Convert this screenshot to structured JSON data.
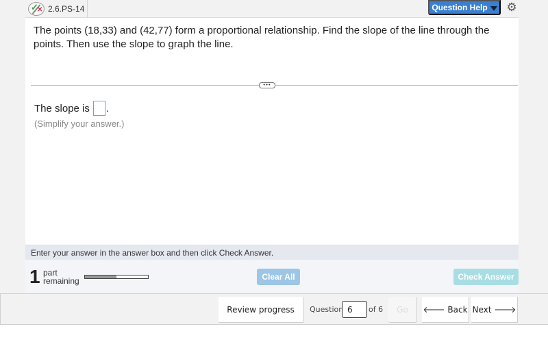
{
  "header": {
    "question_id": "2.6.PS-14",
    "status_icon": "check-cross-icon",
    "help_label": "Question Help",
    "settings_icon": "gear-icon"
  },
  "question": {
    "text": "The points (18,33) and (42,77) form a proportional relationship. Find the slope of the line through the points. Then use the slope to graph the line.",
    "expand_handle": "•••",
    "answer_prefix": "The slope is",
    "answer_value": "",
    "answer_suffix": ".",
    "hint": "(Simplify your answer.)"
  },
  "instruction": "Enter your answer in the answer box and then click Check Answer.",
  "status": {
    "parts_count": "1",
    "parts_label_line1": "part",
    "parts_label_line2": "remaining",
    "progress_fraction": 0.5,
    "clear_label": "Clear All",
    "check_label": "Check Answer"
  },
  "nav": {
    "review_label": "Review progress",
    "question_label": "Question",
    "question_value": "6",
    "of_label": "of 6",
    "go_label": "Go",
    "back_label": "🡐 Back",
    "next_label": "Next 🡒"
  },
  "colors": {
    "help_blue": "#3a7fd0",
    "clear_blue": "#9cc5e6",
    "check_teal": "#a8dee3"
  }
}
